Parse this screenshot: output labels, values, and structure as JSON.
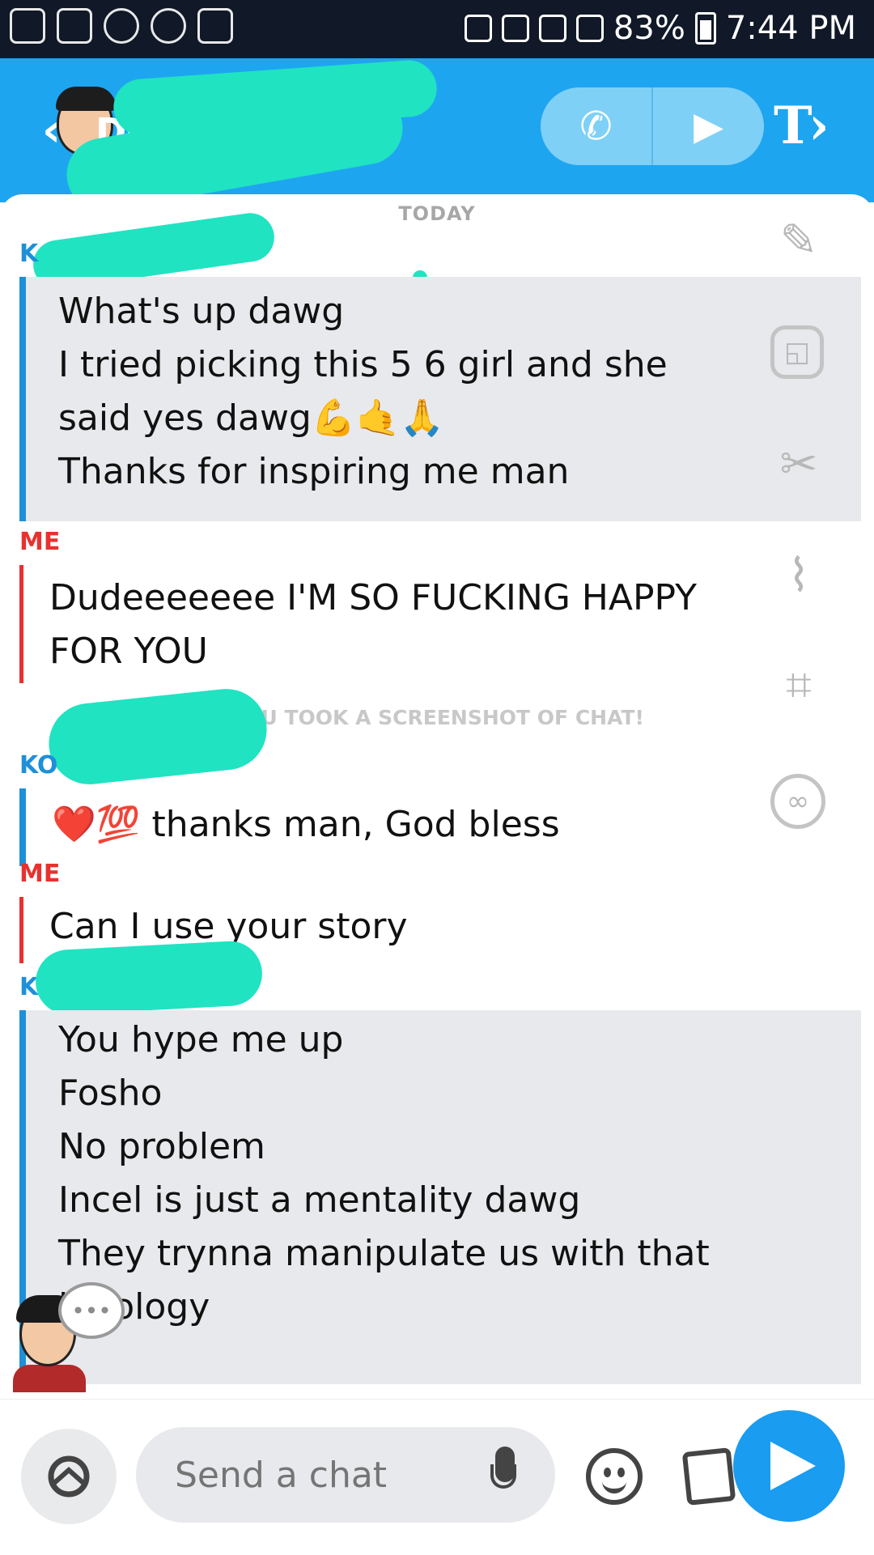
{
  "status_bar": {
    "battery": "83%",
    "time": "7:44 PM"
  },
  "header": {
    "back_label": "Done",
    "call_icon": "phone-icon",
    "video_icon": "video-icon",
    "text_tool_icon": "text-tool-icon"
  },
  "chat": {
    "date_label": "TODAY",
    "blocks": [
      {
        "sender": "K",
        "side": "them",
        "messages": [
          "What's up dawg",
          "I tried picking this 5 6 girl and she said yes dawg💪🤙🙏",
          "Thanks for inspiring me man"
        ]
      },
      {
        "sender": "ME",
        "side": "me",
        "messages": [
          "Dudeeeeeee I'M SO FUCKING HAPPY FOR YOU"
        ]
      },
      {
        "sender": "KO",
        "side": "them",
        "messages": [
          "❤️💯 thanks man, God bless"
        ]
      },
      {
        "sender": "ME",
        "side": "me",
        "messages": [
          "Can I use your story"
        ]
      },
      {
        "sender": "K",
        "side": "them",
        "messages": [
          "You hype me up",
          "Fosho",
          "No problem",
          "Incel is just a mentality dawg",
          "They trynna manipulate us with that ideology"
        ]
      }
    ],
    "system_note": "YOU TOOK A SCREENSHOT OF CHAT!"
  },
  "tools": [
    "pencil-icon",
    "sticker-icon",
    "scissors-icon",
    "paperclip-icon",
    "crop-icon",
    "timer-icon"
  ],
  "composer": {
    "placeholder": "Send a chat",
    "camera_icon": "camera-swap-icon",
    "mic_icon": "mic-icon",
    "emoji_icon": "emoji-icon",
    "sticker_icon": "sticker-card-icon",
    "send_icon": "send-icon"
  },
  "colors": {
    "header_blue": "#1ea5f0",
    "them_accent": "#1e90d8",
    "me_accent": "#e8312f",
    "redaction": "#20e3c2"
  }
}
